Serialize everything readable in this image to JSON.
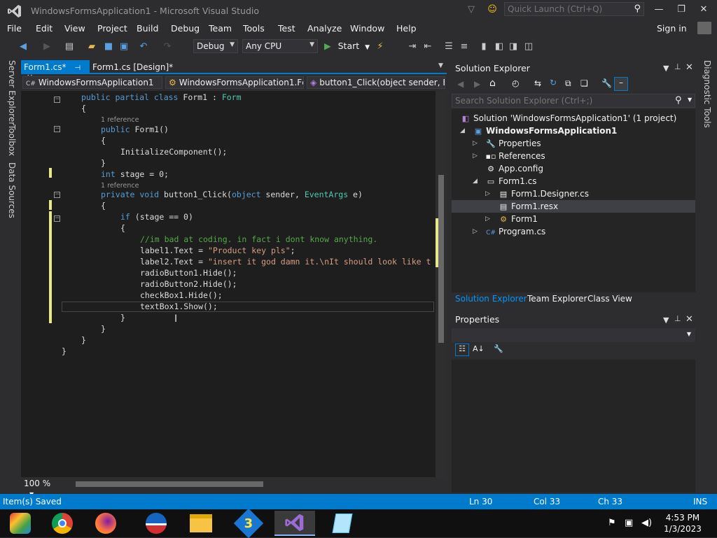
{
  "window": {
    "title": "WindowsFormsApplication1 - Microsoft Visual Studio",
    "quick_launch_placeholder": "Quick Launch (Ctrl+Q)"
  },
  "menubar": {
    "items": [
      "File",
      "Edit",
      "View",
      "Project",
      "Build",
      "Debug",
      "Team",
      "Tools",
      "Test",
      "Analyze",
      "Window",
      "Help"
    ],
    "sign_in": "Sign in"
  },
  "toolbar": {
    "config": "Debug",
    "platform": "Any CPU",
    "start": "Start"
  },
  "left_strip": [
    "Server Explorer",
    "Toolbox",
    "Data Sources"
  ],
  "right_strip": "Diagnostic Tools",
  "editor": {
    "tabs": [
      {
        "label": "Form1.cs*",
        "active": true
      },
      {
        "label": "Form1.cs [Design]*",
        "active": false
      }
    ],
    "nav": {
      "project": "WindowsFormsApplication1",
      "class": "WindowsFormsApplication1.Fc",
      "member": "button1_Click(object sender, E"
    },
    "code": {
      "class_decl": [
        "public partial class ",
        "Form1",
        " : ",
        "Form"
      ],
      "open_brace": "{",
      "ref1": "1 reference",
      "ctor_kw": "public ",
      "ctor_name": "Form1()",
      "init": "InitializeComponent();",
      "close_brace": "}",
      "field_kw": "int",
      "field_rest": " stage = 0;",
      "ref2": "1 reference",
      "method_kw": "private void ",
      "method_name": "button1_Click(",
      "method_type1": "object",
      "method_mid": " sender, ",
      "method_type2": "EventArgs",
      "method_end": " e)",
      "if_kw": "if",
      "if_rest": " (stage == 0)",
      "comment": "//im bad at coding. in fact i dont know anything.",
      "l1_pre": "label1.Text = ",
      "l1_str": "\"Product key pls\"",
      "l1_end": ";",
      "l2_pre": "label2.Text = ",
      "l2_str": "\"insert it god damn it.\\nIt should look like t",
      "rb1": "radioButton1.Hide();",
      "rb2": "radioButton2.Hide();",
      "cb1": "checkBox1.Hide();",
      "tb1": "textBox1.Show();"
    },
    "zoom": "100 %"
  },
  "solution_explorer": {
    "title": "Solution Explorer",
    "search_placeholder": "Search Solution Explorer (Ctrl+;)",
    "tree": [
      {
        "label": "Solution 'WindowsFormsApplication1' (1 project)",
        "icon": "solution-icon"
      },
      {
        "label": "WindowsFormsApplication1",
        "icon": "csharp-project-icon"
      },
      {
        "label": "Properties",
        "icon": "wrench-icon"
      },
      {
        "label": "References",
        "icon": "references-icon"
      },
      {
        "label": "App.config",
        "icon": "config-icon"
      },
      {
        "label": "Form1.cs",
        "icon": "form-icon"
      },
      {
        "label": "Form1.Designer.cs",
        "icon": "csharp-file-icon"
      },
      {
        "label": "Form1.resx",
        "icon": "resx-icon"
      },
      {
        "label": "Form1",
        "icon": "class-icon"
      },
      {
        "label": "Program.cs",
        "icon": "csharp-file-icon"
      }
    ],
    "tabs": [
      "Solution Explorer",
      "Team Explorer",
      "Class View"
    ]
  },
  "properties": {
    "title": "Properties"
  },
  "statusbar": {
    "message": "Item(s) Saved",
    "ln": "Ln 30",
    "col": "Col 33",
    "ch": "Ch 33",
    "mode": "INS"
  },
  "taskbar": {
    "apps": [
      "media-center-icon",
      "chrome-icon",
      "firefox-icon",
      "obama-logo-icon",
      "file-explorer-icon",
      "program-3-icon",
      "visual-studio-icon",
      "notepad-icon"
    ],
    "time": "4:53 PM",
    "date": "1/3/2023"
  },
  "colors": {
    "accent": "#007acc",
    "keyword": "#569cd6",
    "type": "#4ec9b0",
    "string": "#d69d85",
    "comment": "#57a64a"
  }
}
